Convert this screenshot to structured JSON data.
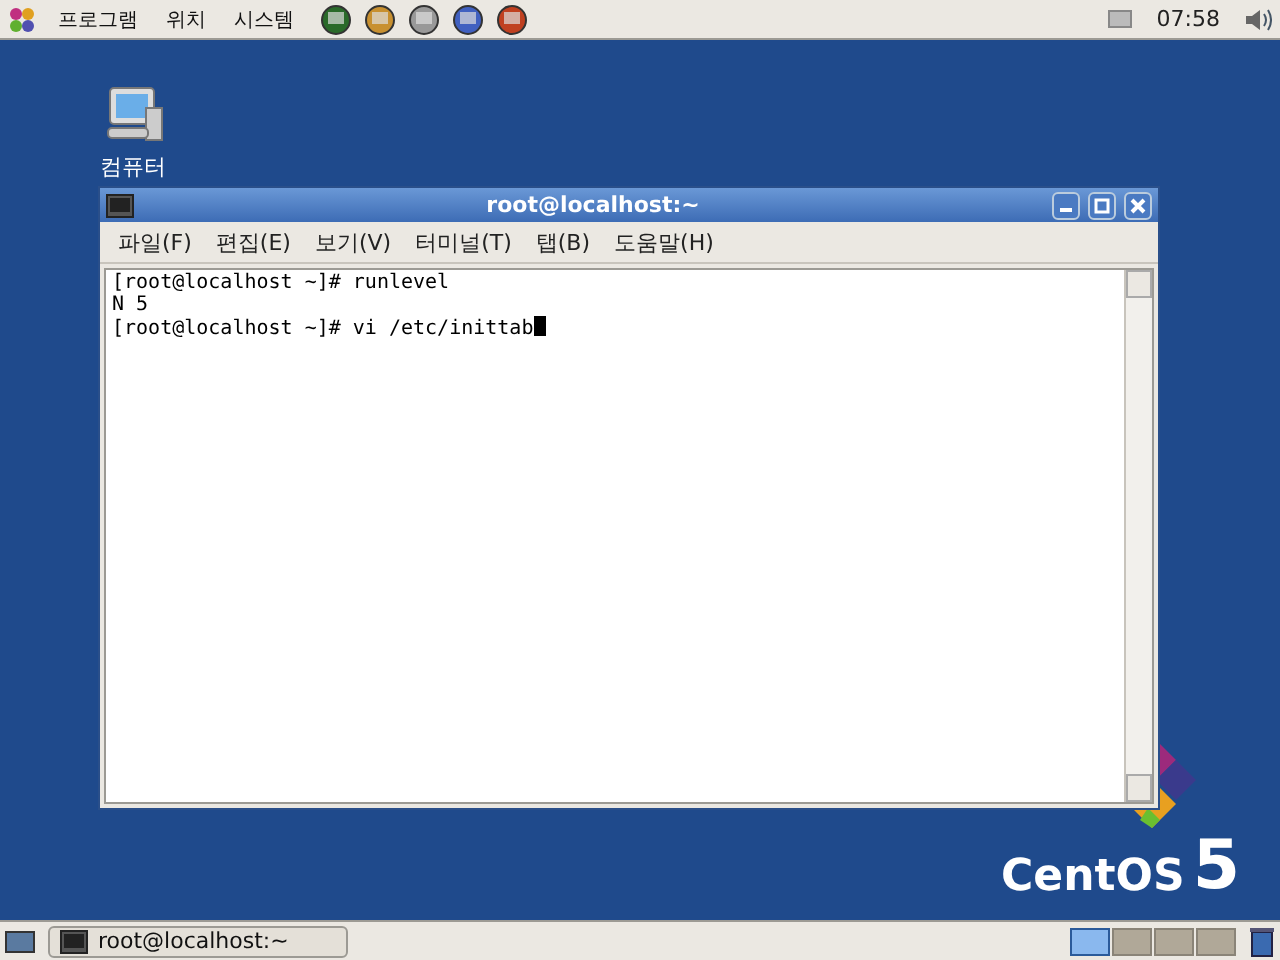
{
  "top_panel": {
    "menus": [
      "프로그램",
      "위치",
      "시스템"
    ],
    "clock": "07:58"
  },
  "desktop_icons": [
    {
      "label": "컴퓨터"
    }
  ],
  "window": {
    "title": "root@localhost:~",
    "menu": [
      "파일(F)",
      "편집(E)",
      "보기(V)",
      "터미널(T)",
      "탭(B)",
      "도움말(H)"
    ],
    "lines": [
      "[root@localhost ~]# runlevel",
      "N 5",
      "[root@localhost ~]# vi /etc/inittab"
    ]
  },
  "wallpaper": {
    "logo": "CentOS",
    "version": "5"
  },
  "taskbar": {
    "tasks": [
      {
        "label": "root@localhost:~"
      }
    ],
    "workspaces": [
      {
        "selected": true
      },
      {
        "selected": false
      },
      {
        "selected": false
      },
      {
        "selected": false
      }
    ]
  }
}
